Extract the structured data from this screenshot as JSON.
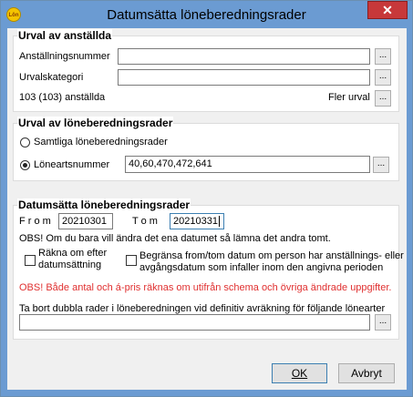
{
  "window": {
    "title": "Datumsätta löneberedningsrader",
    "app_icon_text": "Lön",
    "close_symbol": "✕"
  },
  "urval_anstallda": {
    "title": "Urval av anställda",
    "anstallningsnummer_label": "Anställningsnummer",
    "anstallningsnummer_value": "",
    "urvalskategori_label": "Urvalskategori",
    "urvalskategori_value": "",
    "count_text": "103 (103) anställda",
    "fler_urval_label": "Fler urval",
    "browse_symbol": "..."
  },
  "urval_rader": {
    "title": "Urval av löneberedningsrader",
    "option_all": "Samtliga löneberedningsrader",
    "option_loneart": "Löneartsnummer",
    "selected": "Löneartsnummer",
    "loneart_value": "40,60,470,472,641"
  },
  "datumsatta": {
    "title": "Datumsätta löneberedningsrader",
    "from_label": "F r o m",
    "from_value": "20210301",
    "tom_label": "T o m",
    "tom_value": "20210331",
    "obs_text": "OBS! Om du bara vill ändra det ena datumet så lämna det andra tomt.",
    "rakna_label_1": "Räkna om efter",
    "rakna_label_2": "datumsättning",
    "rakna_checked": false,
    "begransa_label_1": "Begränsa from/tom datum om person har anställnings- eller",
    "begransa_label_2": "avgångsdatum som infaller inom den angivna perioden",
    "begransa_checked": false,
    "warning_text": "OBS! Både antal och á-pris räknas om utifrån schema och övriga ändrade uppgifter.",
    "dubbla_label": "Ta bort dubbla rader i löneberedningen vid definitiv avräkning för följande lönearter",
    "dubbla_value": ""
  },
  "buttons": {
    "ok": "OK",
    "avbryt": "Avbryt"
  }
}
